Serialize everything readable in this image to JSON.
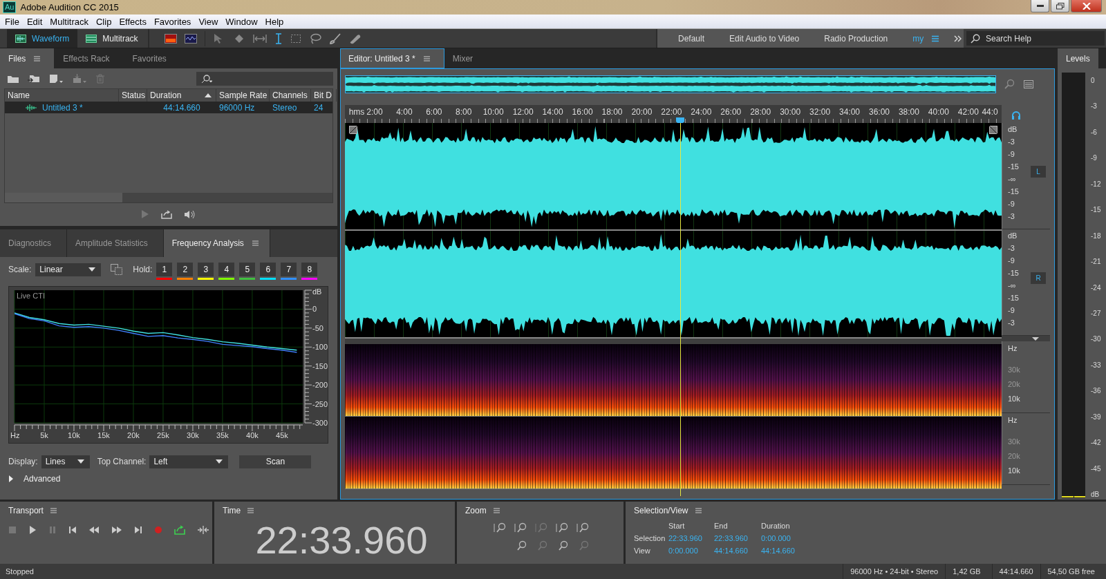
{
  "window": {
    "app_logo": "Au",
    "title": "Adobe Audition CC 2015"
  },
  "menu": [
    "File",
    "Edit",
    "Multitrack",
    "Clip",
    "Effects",
    "Favorites",
    "View",
    "Window",
    "Help"
  ],
  "modes": [
    {
      "label": "Waveform",
      "selected": true
    },
    {
      "label": "Multitrack",
      "selected": false
    }
  ],
  "workspaces": [
    {
      "label": "Default",
      "selected": false
    },
    {
      "label": "Edit Audio to Video",
      "selected": false
    },
    {
      "label": "Radio Production",
      "selected": false
    },
    {
      "label": "my",
      "selected": true
    }
  ],
  "search": {
    "placeholder": "Search Help"
  },
  "files_panel": {
    "tabs": [
      {
        "label": "Files",
        "selected": true
      },
      {
        "label": "Effects Rack",
        "selected": false
      },
      {
        "label": "Favorites",
        "selected": false
      }
    ],
    "columns": [
      {
        "label": "Name"
      },
      {
        "label": "Status"
      },
      {
        "label": "Duration",
        "sorted": true
      },
      {
        "label": "Sample Rate"
      },
      {
        "label": "Channels"
      },
      {
        "label": "Bit D"
      }
    ],
    "rows": [
      {
        "name": "Untitled 3 *",
        "duration": "44:14.660",
        "sample_rate": "96000 Hz",
        "channels": "Stereo",
        "bit_depth": "24",
        "selected": true
      }
    ]
  },
  "analysis_panel": {
    "tabs": [
      {
        "label": "Diagnostics",
        "selected": false
      },
      {
        "label": "Amplitude Statistics",
        "selected": false
      },
      {
        "label": "Frequency Analysis",
        "selected": true
      }
    ],
    "scale_label": "Scale:",
    "scale": "Linear",
    "hold_label": "Hold:",
    "hold": [
      {
        "label": "1",
        "color": "#ff0000"
      },
      {
        "label": "2",
        "color": "#ff8000"
      },
      {
        "label": "3",
        "color": "#ffff00"
      },
      {
        "label": "4",
        "color": "#80ff00"
      },
      {
        "label": "5",
        "color": "#40c040"
      },
      {
        "label": "6",
        "color": "#00e0ff"
      },
      {
        "label": "7",
        "color": "#3090ff"
      },
      {
        "label": "8",
        "color": "#ff00ff"
      }
    ],
    "chart_data": {
      "type": "line",
      "title": "Live CTI",
      "ylabel": "dB",
      "x": [
        0,
        2500,
        5000,
        7500,
        10000,
        12500,
        15000,
        17500,
        20000,
        22500,
        25000,
        27500,
        30000,
        32500,
        35000,
        37500,
        40000,
        42500,
        45000,
        47500
      ],
      "series": [
        {
          "color": "#40e0e0",
          "values": [
            -10,
            -22,
            -28,
            -38,
            -42,
            -40,
            -45,
            -50,
            -58,
            -64,
            -62,
            -68,
            -75,
            -80,
            -86,
            -90,
            -95,
            -100,
            -104,
            -108
          ]
        },
        {
          "color": "#4080ff",
          "values": [
            -12,
            -25,
            -31,
            -44,
            -48,
            -46,
            -50,
            -56,
            -64,
            -72,
            -70,
            -76,
            -80,
            -85,
            -93,
            -96,
            -99,
            -104,
            -108,
            -114
          ]
        }
      ],
      "xlim": [
        0,
        48500
      ],
      "ylim": [
        -300,
        50
      ],
      "grid": true,
      "xticks": [
        {
          "value": 0,
          "label": "Hz"
        },
        {
          "value": 5000,
          "label": "5k"
        },
        {
          "value": 10000,
          "label": "10k"
        },
        {
          "value": 15000,
          "label": "15k"
        },
        {
          "value": 20000,
          "label": "20k"
        },
        {
          "value": 25000,
          "label": "25k"
        },
        {
          "value": 30000,
          "label": "30k"
        },
        {
          "value": 35000,
          "label": "35k"
        },
        {
          "value": 40000,
          "label": "40k"
        },
        {
          "value": 45000,
          "label": "45k"
        }
      ],
      "yticks": [
        0,
        -50,
        -100,
        -150,
        -200,
        -250,
        -300
      ]
    },
    "display_label": "Display:",
    "display": "Lines",
    "top_channel_label": "Top Channel:",
    "top_channel": "Left",
    "scan_button": "Scan",
    "advanced": {
      "label": "Advanced",
      "expanded": false
    }
  },
  "editor": {
    "tabs": [
      {
        "label": "Editor: Untitled 3 *",
        "selected": true
      },
      {
        "label": "Mixer",
        "selected": false
      }
    ],
    "ruler": [
      "hms",
      "2:00",
      "4:00",
      "6:00",
      "8:00",
      "10:00",
      "12:00",
      "14:00",
      "16:00",
      "18:00",
      "20:00",
      "22:00",
      "24:00",
      "26:00",
      "28:00",
      "30:00",
      "32:00",
      "34:00",
      "36:00",
      "38:00",
      "40:00",
      "42:00",
      "44:0"
    ],
    "channels": [
      {
        "badge": "L",
        "scale": [
          "dB",
          "-3",
          "-9",
          "-15",
          "-∞",
          "-15",
          "-9",
          "-3"
        ]
      },
      {
        "badge": "R",
        "scale": [
          "dB",
          "-3",
          "-9",
          "-15",
          "-∞",
          "-15",
          "-9",
          "-3"
        ]
      }
    ],
    "spectral": [
      {
        "scale": [
          "Hz",
          "30k",
          "20k",
          "10k"
        ]
      },
      {
        "scale": [
          "Hz",
          "30k",
          "20k",
          "10k"
        ]
      }
    ]
  },
  "levels": {
    "tab": "Levels",
    "scale": [
      "0",
      "-3",
      "-6",
      "-9",
      "-12",
      "-15",
      "-18",
      "-21",
      "-24",
      "-27",
      "-30",
      "-33",
      "-36",
      "-39",
      "-42",
      "-45",
      "dB"
    ]
  },
  "transport": {
    "title": "Transport"
  },
  "time": {
    "title": "Time",
    "value": "22:33.960"
  },
  "zoom": {
    "title": "Zoom"
  },
  "selection_view": {
    "title": "Selection/View",
    "columns": [
      "Start",
      "End",
      "Duration"
    ],
    "rows": [
      {
        "label": "Selection",
        "values": [
          "22:33.960",
          "22:33.960",
          "0:00.000"
        ]
      },
      {
        "label": "View",
        "values": [
          "0:00.000",
          "44:14.660",
          "44:14.660"
        ]
      }
    ]
  },
  "status_bar": {
    "state": "Stopped",
    "format": "96000 Hz • 24-bit • Stereo",
    "size": "1,42 GB",
    "duration": "44:14.660",
    "free": "54,50 GB free"
  }
}
